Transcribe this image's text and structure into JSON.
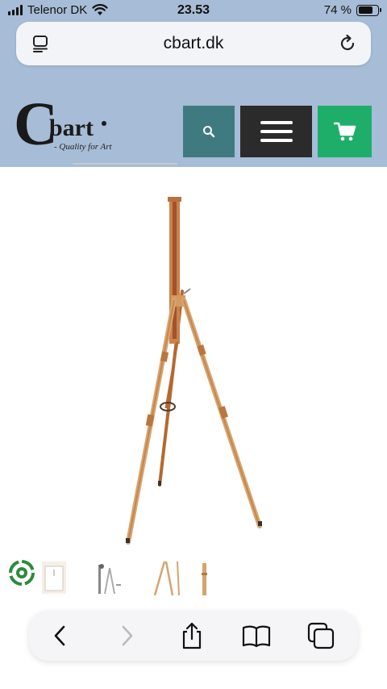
{
  "status_bar": {
    "carrier": "Telenor DK",
    "time": "23.53",
    "battery_percent": "74 %",
    "battery_level": 0.74
  },
  "browser": {
    "url": "cbart.dk",
    "left_icon": "tab-overview-icon",
    "right_icon": "reload-icon"
  },
  "site": {
    "logo_letter": "C",
    "logo_name": "bart",
    "logo_tagline": "- Quality for Art",
    "buttons": {
      "search_icon": "search-icon",
      "menu_icon": "hamburger-menu-icon",
      "cart_icon": "shopping-cart-icon"
    },
    "colors": {
      "search": "#3f7a80",
      "menu": "#2b2b2b",
      "cart": "#1fae69",
      "header_bg": "#a7bcd6"
    }
  },
  "product": {
    "image_subject": "wooden-easel"
  },
  "toolbar": {
    "back": "back-chevron-icon",
    "forward": "forward-chevron-icon",
    "share": "share-icon",
    "bookmarks": "book-icon",
    "tabs": "tabs-icon"
  }
}
